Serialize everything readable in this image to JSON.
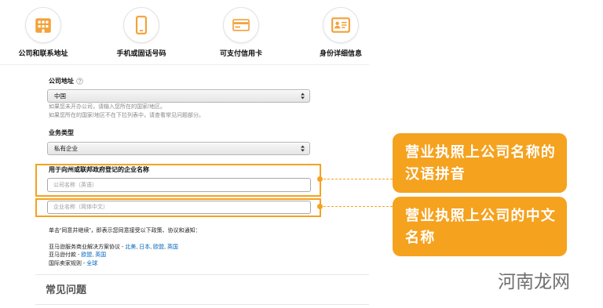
{
  "steps": [
    {
      "label": "公司和联系地址",
      "icon": "building-icon"
    },
    {
      "label": "手机或固话号码",
      "icon": "phone-icon"
    },
    {
      "label": "可支付信用卡",
      "icon": "credit-card-icon"
    },
    {
      "label": "身份详细信息",
      "icon": "id-card-icon"
    }
  ],
  "form": {
    "company_address": {
      "label": "公司地址",
      "help_icon": "help-icon",
      "selected": "中国",
      "help_lines": [
        "如果您未开办公司，请输入您所在的国家/地区。",
        "如果您所在的国家/地区不在下拉列表中，请查看常见问题部分。"
      ]
    },
    "business_type": {
      "label": "业务类型",
      "selected": "私有企业"
    },
    "business_name": {
      "label": "用于向州或联邦政府登记的企业名称",
      "english_placeholder": "公司名称（英语）",
      "chinese_placeholder": "企业名称（简体中文）"
    }
  },
  "agreement": {
    "intro": "单击“同意并继续”，即表示您同意接受以下政策、协议和通知：",
    "link_separator": ", ",
    "items": [
      {
        "name": "亚马逊服务商业解决方案协议 - ",
        "links": [
          "北美",
          "日本",
          "欧盟",
          "英国"
        ]
      },
      {
        "name": "亚马逊付款 - ",
        "links": [
          "欧盟",
          "英国"
        ]
      },
      {
        "name": "国际卖家规则 - ",
        "links": [
          "全球"
        ]
      }
    ]
  },
  "faq": {
    "title": "常见问题"
  },
  "callouts": [
    {
      "lines": [
        "营业执照上公司名称的",
        "汉语拼音"
      ]
    },
    {
      "lines": [
        "营业执照上公司的中文",
        "名称"
      ]
    }
  ],
  "watermark": "河南龙网",
  "colors": {
    "accent": "#f5a21f",
    "icon": "#f3a13a",
    "link": "#0066c0",
    "help_text": "#888888",
    "callout_text": "#ffffff"
  }
}
